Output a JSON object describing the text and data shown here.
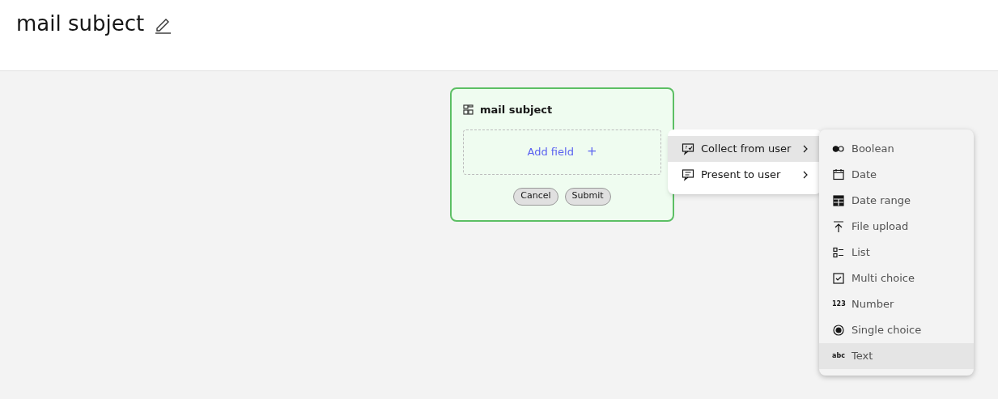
{
  "page": {
    "title": "mail subject"
  },
  "card": {
    "title": "mail subject",
    "add_field": "Add field",
    "add_icon": "+",
    "buttons": [
      "Cancel",
      "Submit"
    ]
  },
  "menu": [
    {
      "kind": "collect",
      "label": "Collect from user",
      "selected": true
    },
    {
      "kind": "present",
      "label": "Present to user",
      "selected": false
    }
  ],
  "submenu": [
    {
      "kind": "boolean",
      "label": "Boolean",
      "selected": false
    },
    {
      "kind": "date",
      "label": "Date",
      "selected": false
    },
    {
      "kind": "daterange",
      "label": "Date range",
      "selected": false
    },
    {
      "kind": "upload",
      "label": "File upload",
      "selected": false
    },
    {
      "kind": "list",
      "label": "List",
      "selected": false
    },
    {
      "kind": "multi",
      "label": "Multi choice",
      "selected": false
    },
    {
      "kind": "glyph",
      "glyph": "123",
      "label": "Number",
      "selected": false
    },
    {
      "kind": "single",
      "label": "Single choice",
      "selected": false
    },
    {
      "kind": "glyph",
      "glyph": "abc",
      "label": "Text",
      "selected": true
    }
  ]
}
